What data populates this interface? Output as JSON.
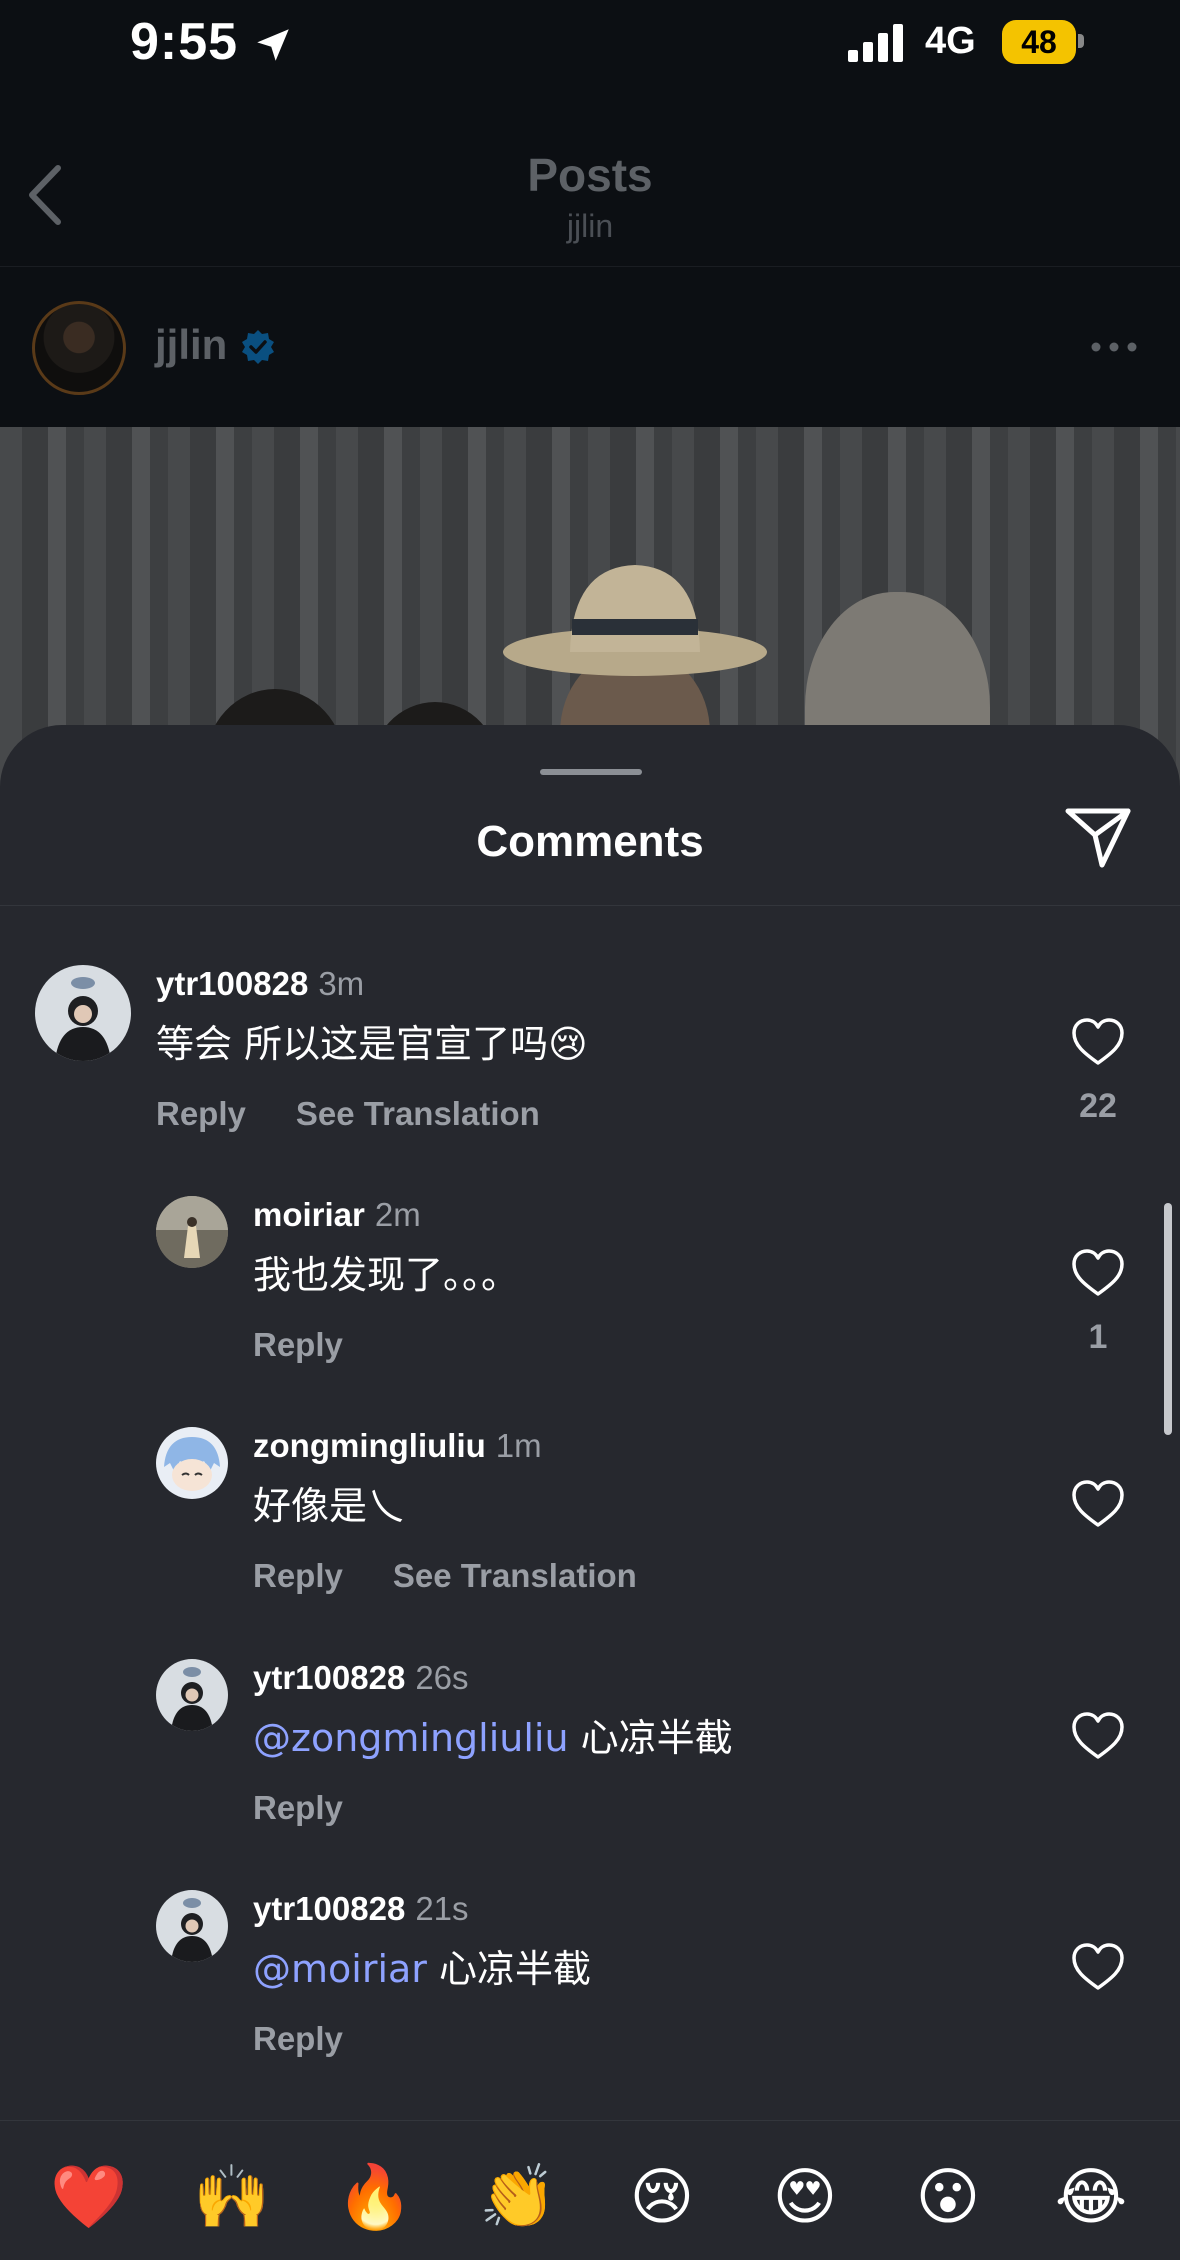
{
  "status_bar": {
    "time": "9:55",
    "network": "4G",
    "battery": "48"
  },
  "header": {
    "title": "Posts",
    "subtitle": "jjlin"
  },
  "post": {
    "username": "jjlin"
  },
  "sheet": {
    "title": "Comments"
  },
  "comments": [
    {
      "user": "ytr100828",
      "time": "3m",
      "text": "等会 所以这是官宣了吗😢",
      "reply": "Reply",
      "translate": "See Translation",
      "likes": "22"
    },
    {
      "user": "moiriar",
      "time": "2m",
      "text": "我也发现了。。。",
      "reply": "Reply",
      "likes": "1"
    },
    {
      "user": "zongmingliuliu",
      "time": "1m",
      "text": "好像是乀",
      "reply": "Reply",
      "translate": "See Translation"
    },
    {
      "user": "ytr100828",
      "time": "26s",
      "mention": "@zongmingliuliu",
      "text": " 心凉半截",
      "reply": "Reply"
    },
    {
      "user": "ytr100828",
      "time": "21s",
      "mention": "@moiriar",
      "text": " 心凉半截",
      "reply": "Reply"
    }
  ],
  "emoji_bar": [
    "❤️",
    "🙌",
    "🔥",
    "👏",
    "😢",
    "😍",
    "😮",
    "😂"
  ],
  "colors": {
    "sheet_bg": "#26282e",
    "mention": "#8ea2ff",
    "secondary_text": "#9a9ea5",
    "verified": "#0095f6",
    "battery": "#f4c300"
  }
}
